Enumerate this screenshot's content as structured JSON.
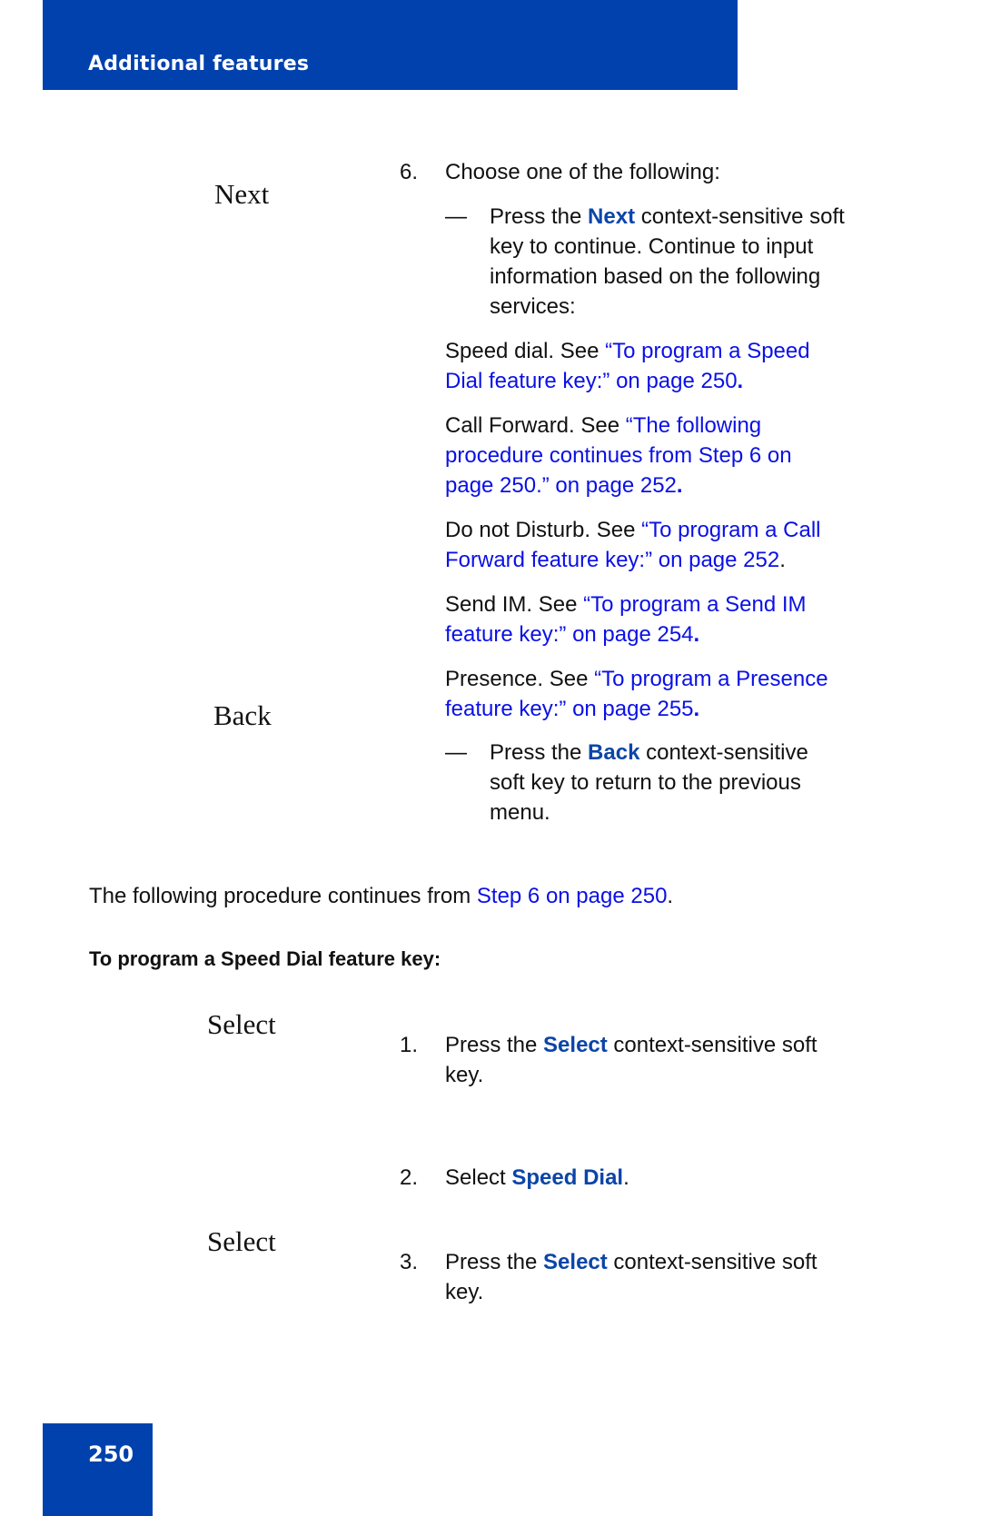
{
  "header": {
    "section_title": "Additional features"
  },
  "softkeys": {
    "next": "Next",
    "back": "Back",
    "select_1": "Select",
    "select_2": "Select"
  },
  "step6": {
    "number": "6.",
    "intro": "Choose one of the following:",
    "dash": "—",
    "next_option": {
      "pre": "Press the ",
      "key": "Next",
      "line1_post": " context-sensitive soft",
      "line2": "key to continue. Continue to input",
      "line3": "information based on the following",
      "line4": "services:"
    },
    "services": [
      {
        "label": "Speed dial. See ",
        "link_line1": "“To program a Speed",
        "link_line2": "Dial feature key:” on page 250",
        "end": "."
      },
      {
        "label": "Call Forward. See ",
        "link_line1": "“The following",
        "link_line2": "procedure continues from  Step 6 on",
        "link_line3": "page 250.” on page 252",
        "end": "."
      },
      {
        "label": "Do not Disturb. See ",
        "link_line1": "“To program a Call",
        "link_line2": "Forward feature key:” on page 252",
        "end": "."
      },
      {
        "label": "Send IM. See ",
        "link_line1": "“To program a Send IM",
        "link_line2": "feature key:” on page 254",
        "end": "."
      },
      {
        "label": "Presence. See ",
        "link_line1": "“To program a Presence",
        "link_line2": "feature key:” on page 255",
        "end": "."
      }
    ],
    "back_option": {
      "pre": "Press the ",
      "key": "Back",
      "line1_post": " context-sensitive",
      "line2": "soft key to return to the previous",
      "line3": "menu."
    }
  },
  "continuation": {
    "text": "The following procedure continues from  ",
    "link": "Step 6 on page 250",
    "end": "."
  },
  "procedure": {
    "heading": "To program a Speed Dial feature key:",
    "steps": [
      {
        "number": "1.",
        "pre": "Press the ",
        "key": "Select",
        "post": " context-sensitive soft",
        "line2": "key."
      },
      {
        "number": "2.",
        "pre": "Select ",
        "key": "Speed Dial",
        "post": "."
      },
      {
        "number": "3.",
        "pre": "Press the ",
        "key": "Select",
        "post": " context-sensitive soft",
        "line2": "key."
      }
    ]
  },
  "footer": {
    "page_number": "250"
  }
}
